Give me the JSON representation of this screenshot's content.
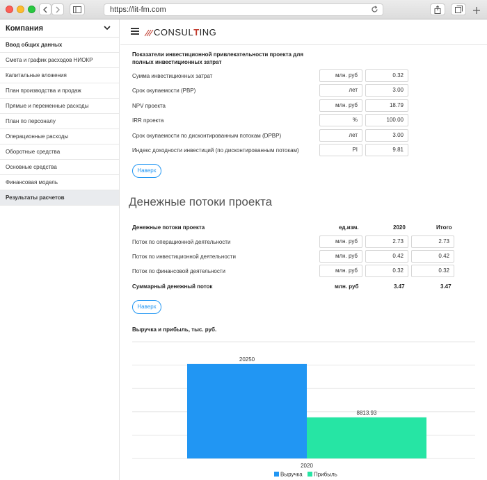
{
  "browser": {
    "url": "https://lit-fm.com"
  },
  "sidebar": {
    "title": "Компания",
    "items": [
      {
        "label": "Ввод общих данных"
      },
      {
        "label": "Смета и график расходов НИОКР"
      },
      {
        "label": "Капитальные вложения"
      },
      {
        "label": "План производства и продаж"
      },
      {
        "label": "Прямые и переменные расходы"
      },
      {
        "label": "План по персоналу"
      },
      {
        "label": "Операционные расходы"
      },
      {
        "label": "Оборотные средства"
      },
      {
        "label": "Основные средства"
      },
      {
        "label": "Финансовая модель"
      },
      {
        "label": "Результаты расчетов"
      }
    ]
  },
  "logo": {
    "text_a": "CONSUL",
    "text_b": "T",
    "text_c": "ING"
  },
  "investment": {
    "title": "Показатели инвестиционной привлекательности проекта для полных инвестиционных затрат",
    "rows": [
      {
        "label": "Сумма инвестиционных затрат",
        "unit": "млн. руб",
        "value": "0.32"
      },
      {
        "label": "Срок окупаемости (PBP)",
        "unit": "лет",
        "value": "3.00"
      },
      {
        "label": "NPV проекта",
        "unit": "млн. руб",
        "value": "18.79"
      },
      {
        "label": "IRR проекта",
        "unit": "%",
        "value": "100.00"
      },
      {
        "label": "Срок окупаемости по дисконтированным потокам (DPBP)",
        "unit": "лет",
        "value": "3.00"
      },
      {
        "label": "Индекс доходности инвестиций (по дисконтированным потокам)",
        "unit": "PI",
        "value": "9.81"
      }
    ],
    "up_button": "Наверх"
  },
  "cashflow": {
    "heading": "Денежные потоки проекта",
    "columns": {
      "name": "Денежные потоки проекта",
      "unit": "ед.изм.",
      "year": "2020",
      "total": "Итого"
    },
    "rows": [
      {
        "label": "Поток по операционной деятельности",
        "unit": "млн. руб",
        "year": "2.73",
        "total": "2.73"
      },
      {
        "label": "Поток по инвестиционной деятельности",
        "unit": "млн. руб",
        "year": "0.42",
        "total": "0.42"
      },
      {
        "label": "Поток по финансовой деятельности",
        "unit": "млн. руб",
        "year": "0.32",
        "total": "0.32"
      }
    ],
    "summary": {
      "label": "Суммарный денежный поток",
      "unit": "млн. руб",
      "year": "3.47",
      "total": "3.47"
    },
    "up_button": "Наверх"
  },
  "chart_title": "Выручка и прибыль, тыс. руб.",
  "chart_data": {
    "type": "bar",
    "categories": [
      "2020"
    ],
    "series": [
      {
        "name": "Выручка",
        "values": [
          20250
        ],
        "color": "#2196f3"
      },
      {
        "name": "Прибыль",
        "values": [
          8813.93
        ],
        "color": "#26e5a4"
      }
    ],
    "value_labels": [
      "20250",
      "8813.93"
    ],
    "ylim": [
      0,
      25000
    ],
    "grid": true,
    "legend": "bottom"
  }
}
